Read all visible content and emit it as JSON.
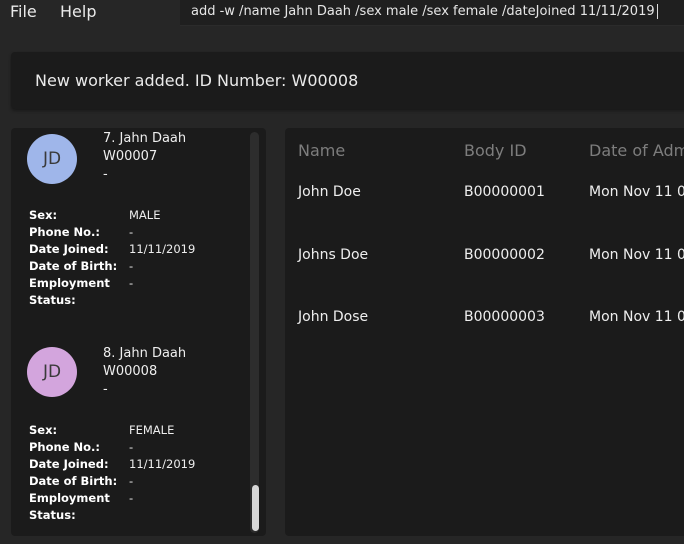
{
  "menu": {
    "file": "File",
    "help": "Help"
  },
  "command": {
    "value": "add -w /name Jahn Daah /sex male /sex female /dateJoined 11/11/2019"
  },
  "result": {
    "message": "New worker added. ID Number: W00008"
  },
  "workers": [
    {
      "initials": "JD",
      "avatar_color": "#9fb6ea",
      "title": "7. Jahn Daah",
      "id": "W00007",
      "extra": "-",
      "fields": [
        {
          "label": "Sex:",
          "value": "MALE"
        },
        {
          "label": "Phone No.:",
          "value": "-"
        },
        {
          "label": "Date Joined:",
          "value": "11/11/2019"
        },
        {
          "label": "Date of Birth:",
          "value": "-"
        },
        {
          "label": "Employment",
          "value": "-"
        },
        {
          "label": "Status:",
          "value": ""
        }
      ]
    },
    {
      "initials": "JD",
      "avatar_color": "#d3a5dd",
      "title": "8. Jahn Daah",
      "id": "W00008",
      "extra": "-",
      "fields": [
        {
          "label": "Sex:",
          "value": "FEMALE"
        },
        {
          "label": "Phone No.:",
          "value": "-"
        },
        {
          "label": "Date Joined:",
          "value": "11/11/2019"
        },
        {
          "label": "Date of Birth:",
          "value": "-"
        },
        {
          "label": "Employment",
          "value": "-"
        },
        {
          "label": "Status:",
          "value": ""
        }
      ]
    }
  ],
  "table": {
    "columns": [
      "Name",
      "Body ID",
      "Date of Admission"
    ],
    "rows": [
      [
        "John Doe",
        "B00000001",
        "Mon Nov 11 0"
      ],
      [
        "Johns Doe",
        "B00000002",
        "Mon Nov 11 0"
      ],
      [
        "John Dose",
        "B00000003",
        "Mon Nov 11 0"
      ]
    ]
  }
}
